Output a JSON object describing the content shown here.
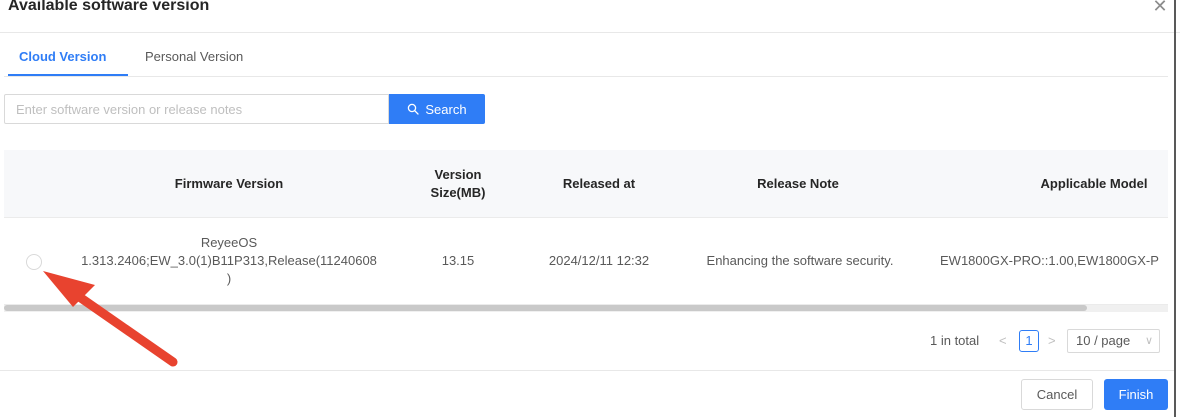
{
  "dialog": {
    "title": "Available software version",
    "close_glyph": "✕"
  },
  "tabs": [
    {
      "label": "Cloud Version",
      "active": true
    },
    {
      "label": "Personal Version",
      "active": false
    }
  ],
  "search": {
    "placeholder": "Enter software version or release notes",
    "button_label": "Search",
    "icon": "search-icon"
  },
  "table": {
    "columns": {
      "firmware_version": "Firmware Version",
      "version_size": "Version Size(MB)",
      "released_at": "Released at",
      "release_note": "Release Note",
      "applicable_model": "Applicable Model"
    },
    "rows": [
      {
        "firmware_line1": "ReyeeOS",
        "firmware_line2": "1.313.2406;EW_3.0(1)B11P313,Release(11240608",
        "firmware_line3": ")",
        "size": "13.15",
        "released": "2024/12/11 12:32",
        "note": "Enhancing the software security.",
        "model": "EW1800GX-PRO::1.00,EW1800GX-P",
        "selected": false
      }
    ]
  },
  "pagination": {
    "total_text": "1 in total",
    "prev_glyph": "<",
    "current_page": "1",
    "next_glyph": ">",
    "page_size": "10 / page",
    "page_size_chevron": "∨"
  },
  "footer": {
    "cancel_label": "Cancel",
    "finish_label": "Finish"
  },
  "annotation": {
    "color": "#e8432f"
  },
  "colors": {
    "accent": "#2f7df6"
  }
}
